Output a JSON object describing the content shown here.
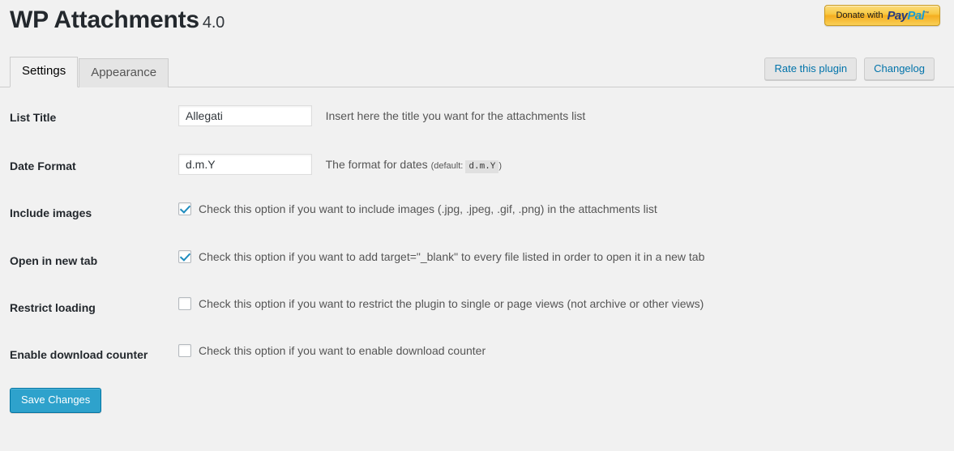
{
  "header": {
    "title": "WP Attachments",
    "version": "4.0",
    "donate_button": {
      "prefix": "Donate with",
      "logo_first": "Pay",
      "logo_second": "Pal",
      "trademark": "™"
    }
  },
  "tabs": [
    {
      "label": "Settings",
      "active": true
    },
    {
      "label": "Appearance",
      "active": false
    }
  ],
  "tab_actions": [
    {
      "label": "Rate this plugin"
    },
    {
      "label": "Changelog"
    }
  ],
  "settings": {
    "list_title": {
      "label": "List Title",
      "value": "Allegati",
      "placeholder": "",
      "description": "Insert here the title you want for the attachments list"
    },
    "date_format": {
      "label": "Date Format",
      "value": "d.m.Y",
      "placeholder": "",
      "description": "The format for dates",
      "default_prefix": "(default:",
      "default_code": "d.m.Y",
      "default_suffix": ")"
    },
    "include_images": {
      "label": "Include images",
      "checked": true,
      "description": "Check this option if you want to include images (.jpg, .jpeg, .gif, .png) in the attachments list"
    },
    "open_in_new_tab": {
      "label": "Open in new tab",
      "checked": true,
      "description": "Check this option if you want to add target=\"_blank\" to every file listed in order to open it in a new tab"
    },
    "restrict_loading": {
      "label": "Restrict loading",
      "checked": false,
      "description": "Check this option if you want to restrict the plugin to single or page views (not archive or other views)"
    },
    "enable_download_counter": {
      "label": "Enable download counter",
      "checked": false,
      "description": "Check this option if you want to enable download counter"
    }
  },
  "submit": {
    "save_label": "Save Changes"
  },
  "colors": {
    "page_background": "#f1f1f1",
    "primary_button": "#2ea2cc",
    "link_blue": "#0073aa",
    "checkbox_check": "#1e8cbe",
    "paypal_orange": "#f8c944",
    "paypal_navy": "#253b80",
    "paypal_light_blue": "#179bd7"
  }
}
